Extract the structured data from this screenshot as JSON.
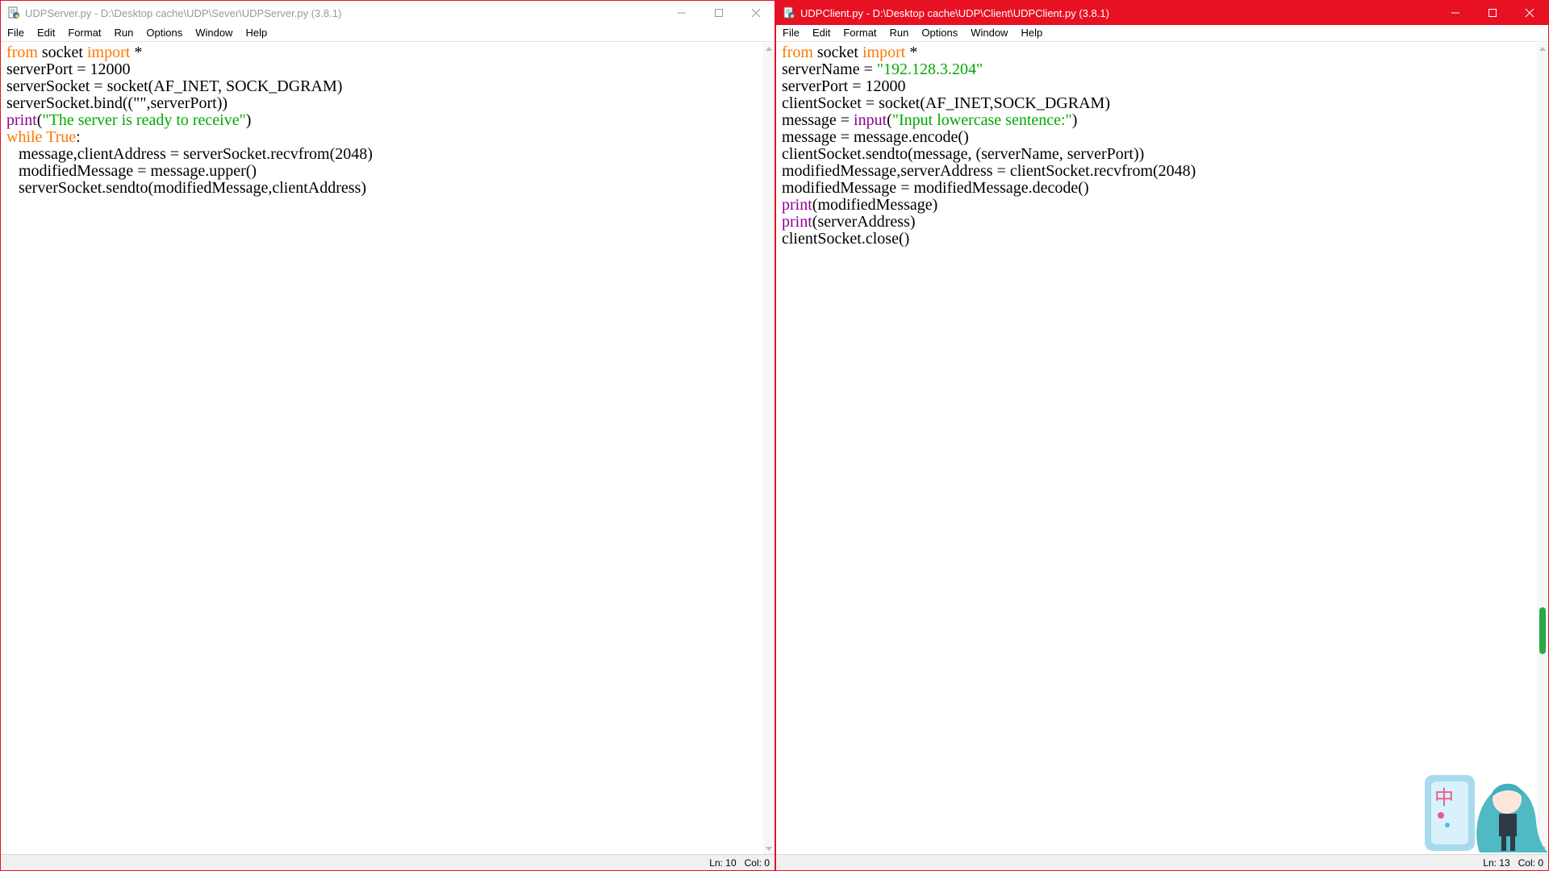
{
  "server_window": {
    "title": "UDPServer.py - D:\\Desktop cache\\UDP\\Sever\\UDPServer.py (3.8.1)",
    "menu": [
      "File",
      "Edit",
      "Format",
      "Run",
      "Options",
      "Window",
      "Help"
    ],
    "code": [
      [
        {
          "t": "from",
          "c": "kw"
        },
        {
          "t": " socket ",
          "c": ""
        },
        {
          "t": "import",
          "c": "kw"
        },
        {
          "t": " *",
          "c": ""
        }
      ],
      [
        {
          "t": "serverPort = 12000",
          "c": ""
        }
      ],
      [
        {
          "t": "serverSocket = socket(AF_INET, SOCK_DGRAM)",
          "c": ""
        }
      ],
      [
        {
          "t": "serverSocket.bind((\"\",serverPort))",
          "c": ""
        }
      ],
      [
        {
          "t": "print",
          "c": "bi"
        },
        {
          "t": "(",
          "c": ""
        },
        {
          "t": "\"The server is ready to receive\"",
          "c": "str"
        },
        {
          "t": ")",
          "c": ""
        }
      ],
      [
        {
          "t": "while",
          "c": "kw"
        },
        {
          "t": " ",
          "c": ""
        },
        {
          "t": "True",
          "c": "kw"
        },
        {
          "t": ":",
          "c": ""
        }
      ],
      [
        {
          "t": "   message,clientAddress = serverSocket.recvfrom(2048)",
          "c": ""
        }
      ],
      [
        {
          "t": "   modifiedMessage = message.upper()",
          "c": ""
        }
      ],
      [
        {
          "t": "   serverSocket.sendto(modifiedMessage,clientAddress)",
          "c": ""
        }
      ]
    ],
    "status": {
      "line": "Ln: 10",
      "col": "Col: 0"
    }
  },
  "client_window": {
    "title": "UDPClient.py - D:\\Desktop cache\\UDP\\Client\\UDPClient.py (3.8.1)",
    "menu": [
      "File",
      "Edit",
      "Format",
      "Run",
      "Options",
      "Window",
      "Help"
    ],
    "code": [
      [
        {
          "t": "from",
          "c": "kw"
        },
        {
          "t": " socket ",
          "c": ""
        },
        {
          "t": "import",
          "c": "kw"
        },
        {
          "t": " *",
          "c": ""
        }
      ],
      [
        {
          "t": "serverName = ",
          "c": ""
        },
        {
          "t": "\"192.128.3.204\"",
          "c": "str"
        }
      ],
      [
        {
          "t": "serverPort = 12000",
          "c": ""
        }
      ],
      [
        {
          "t": "clientSocket = socket(AF_INET,SOCK_DGRAM)",
          "c": ""
        }
      ],
      [
        {
          "t": "message = ",
          "c": ""
        },
        {
          "t": "input",
          "c": "bi"
        },
        {
          "t": "(",
          "c": ""
        },
        {
          "t": "\"Input lowercase sentence:\"",
          "c": "str"
        },
        {
          "t": ")",
          "c": ""
        }
      ],
      [
        {
          "t": "message = message.encode()",
          "c": ""
        }
      ],
      [
        {
          "t": "clientSocket.sendto(message, (serverName, serverPort))",
          "c": ""
        }
      ],
      [
        {
          "t": "modifiedMessage,serverAddress = clientSocket.recvfrom(2048)",
          "c": ""
        }
      ],
      [
        {
          "t": "modifiedMessage = modifiedMessage.decode()",
          "c": ""
        }
      ],
      [
        {
          "t": "print",
          "c": "bi"
        },
        {
          "t": "(modifiedMessage)",
          "c": ""
        }
      ],
      [
        {
          "t": "print",
          "c": "bi"
        },
        {
          "t": "(serverAddress)",
          "c": ""
        }
      ],
      [
        {
          "t": "clientSocket.close()",
          "c": ""
        }
      ]
    ],
    "status": {
      "line": "Ln: 13",
      "col": "Col: 0"
    }
  },
  "ime": {
    "glyph": "中"
  },
  "colors": {
    "keyword": "#ff7700",
    "builtin": "#900090",
    "string": "#00aa00",
    "active_titlebar": "#e81123"
  },
  "icons": [
    "python-idle-icon",
    "minimize-icon",
    "maximize-icon",
    "close-icon"
  ]
}
